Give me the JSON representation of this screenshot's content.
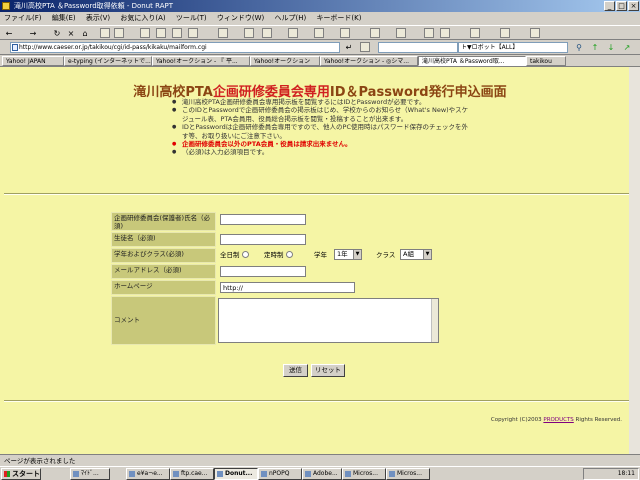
{
  "window": {
    "title": "滝川高校PTA ＆Password取得依頼 - Donut RAPT",
    "min": "_",
    "max": "□",
    "close": "×"
  },
  "menu": [
    "ファイル(F)",
    "編集(E)",
    "表示(V)",
    "お気に入り(A)",
    "ツール(T)",
    "ウィンドウ(W)",
    "ヘルプ(H)",
    "キーボード(K)"
  ],
  "toolbar": {
    "back": "←",
    "forward": "→",
    "refresh": "↻",
    "home": "⌂",
    "stop": "×"
  },
  "address": {
    "url": "http://www.caeser.or.jp/takikou/cgi/id-pass/kikaku/mailform.cgi",
    "robot": "ト▼ロボット【ALL】"
  },
  "tabs": [
    "Yahoo! JAPAN",
    "e-typing (インターネットで...",
    "Yahoo!オークション - 『 平...",
    "Yahoo!オークション",
    "Yahoo!オークション - ◎シマ...",
    "滝川高校PTA ＆Password取...",
    "takikou"
  ],
  "page": {
    "title_prefix": "滝川高校PTA",
    "title_red": "企画研修委員会専用",
    "title_suffix": "ID＆Password発行申込画面",
    "bullets": [
      "滝川高校PTA企画研修委員会専用掲示板を閲覧するにはIDとPasswordが必要です。",
      "このIDとPasswordで企画研修委員会の掲示板はじめ、学校からのお知らせ（What's New)やスケジュール表、PTA会員用、役員総合掲示板を閲覧・投稿することが出来ます。",
      "IDとPasswordは企画研修委員会専用ですので、他人のPC使用時はパスワード保存のチェックを外す等、お取り扱いにご注意下さい。",
      "企画研修委員会以外のPTA会員・役員は請求出来ません。",
      "（必須)は入力必須項目です。"
    ],
    "form": {
      "name_label": "企画研修委員会(保護者)氏名（必須)",
      "student_label": "生徒名（必須)",
      "grade_label": "学年およびクラス(必須)",
      "fulltime": "全日制",
      "parttime": "定時制",
      "grade_word": "学年",
      "grade_value": "1年",
      "class_word": "クラス",
      "class_value": "A組",
      "mail_label": "メールアドレス（必須)",
      "homepage_label": "ホームページ",
      "homepage_value": "http://",
      "comment_label": "コメント",
      "submit": "送信",
      "reset": "リセット"
    },
    "copyright_prefix": "Copyright (C)2003",
    "copyright_link": "PRODUCTS",
    "copyright_suffix": "Rights Reserved."
  },
  "status": "ページが表示されました",
  "taskbar": {
    "start": "スタート",
    "tasks": [
      "ﾏｲﾄﾞ...",
      "e¥a¬e...",
      "ftp.cae...",
      "Donut...",
      "nPOPQ",
      "Adobe...",
      "Micros...",
      "Micros..."
    ],
    "clock": "18:11"
  }
}
